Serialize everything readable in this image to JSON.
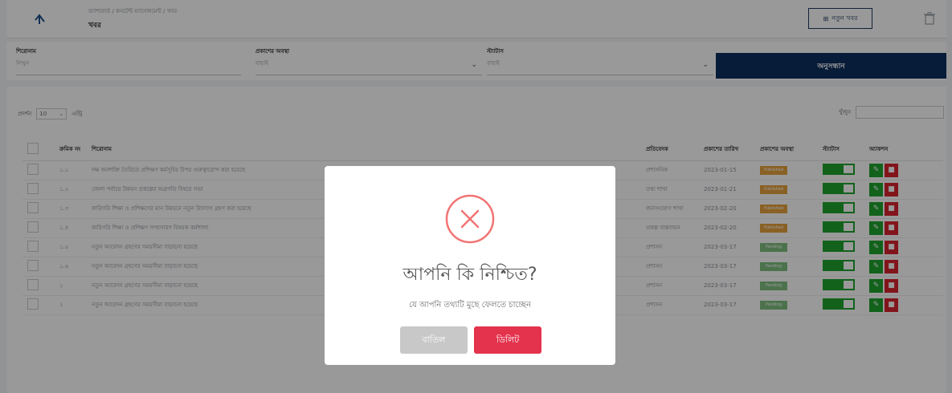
{
  "header": {
    "breadcrumb": "ড্যাশবোর্ড / কনটেন্ট ম্যানেজমেন্ট / খবর",
    "title": "খবর",
    "new_button_label": "নতুন খবর"
  },
  "filters": {
    "title_label": "শিরোনাম",
    "title_placeholder": "লিখুন",
    "publish_status_label": "প্রকাশের অবস্থা",
    "publish_status_value": "বাছাই",
    "status_label": "স্ট্যাটাস",
    "status_value": "বাছাই",
    "search_button_label": "অনুসন্ধান"
  },
  "table_controls": {
    "show_label": "প্রদর্শন",
    "page_size": "10",
    "entries_label": "এন্ট্রি",
    "search_label": "খুঁজুন"
  },
  "table": {
    "columns": [
      "ক্রমিক নং",
      "শিরোনাম",
      "প্রতিবেদক",
      "প্রকাশের তারিখ",
      "প্রকাশের অবস্থা",
      "স্ট্যাটাস",
      "অ্যাকশন"
    ],
    "rows": [
      {
        "serial": "১.১",
        "title": "দক্ষ জনশক্তি তৈরিতে প্রশিক্ষণ কর্মসূচির উপর গুরুত্বারোপ করা হয়েছে",
        "reporter": "প্রশাসনিক",
        "date": "2023-01-15",
        "status": "Published",
        "status_color": "#e6a23c"
      },
      {
        "serial": "১.২",
        "title": "জেলা পর্যায়ে উন্নয়ন প্রকল্পের অগ্রগতি বিষয়ে সভা",
        "reporter": "তথ্য শাখা",
        "date": "2023-01-21",
        "status": "Published",
        "status_color": "#e6a23c"
      },
      {
        "serial": "১.৩",
        "title": "কারিগরি শিক্ষা ও প্রশিক্ষণের মান উন্নয়নে নতুন উদ্যোগ গ্রহণ করা হয়েছে",
        "reporter": "জনসংযোগ শাখা",
        "date": "2023-02-20",
        "status": "Published",
        "status_color": "#e6a23c"
      },
      {
        "serial": "১.৪",
        "title": "কারিগরি শিক্ষা ও প্রশিক্ষণ সম্প্রসারণ বিষয়ক কর্মশালা",
        "reporter": "প্রকল্প বাস্তবায়ন",
        "date": "2023-02-20",
        "status": "Published",
        "status_color": "#e6a23c"
      },
      {
        "serial": "১.৫",
        "title": "নতুন আবেদন গ্রহণের সময়সীমা বাড়ানো হয়েছে",
        "reporter": "প্রশাসন",
        "date": "2023-03-17",
        "status": "Pending",
        "status_color": "#7fbf7f"
      },
      {
        "serial": "১.৬",
        "title": "নতুন আবেদন গ্রহণের সময়সীমা বাড়ানো হয়েছে",
        "reporter": "প্রশাসন",
        "date": "2023-03-17",
        "status": "Pending",
        "status_color": "#7fbf7f"
      },
      {
        "serial": "১",
        "title": "নতুন আবেদন গ্রহণের সময়সীমা বাড়ানো হয়েছে",
        "reporter": "প্রশাসন",
        "date": "2023-03-17",
        "status": "Pending",
        "status_color": "#7fbf7f"
      },
      {
        "serial": "২",
        "title": "নতুন আবেদন গ্রহণের সময়সীমা বাড়ানো হয়েছে",
        "reporter": "প্রশাসন",
        "date": "2023-03-17",
        "status": "Pending",
        "status_color": "#7fbf7f"
      }
    ]
  },
  "modal": {
    "title": "আপনি কি নিশ্চিত?",
    "text": "যে আপনি তথ্যটি মুছে ফেলতে চাচ্ছেন",
    "cancel_label": "বাতিল",
    "confirm_label": "ডিলিট",
    "icon": "error-x-icon",
    "icon_color": "#f27474",
    "confirm_color": "#e3334d",
    "cancel_color": "#c8c8c8"
  },
  "colors": {
    "primary": "#0d2f5e",
    "toggle_on": "#1fa42e",
    "delete": "#d9242f"
  }
}
